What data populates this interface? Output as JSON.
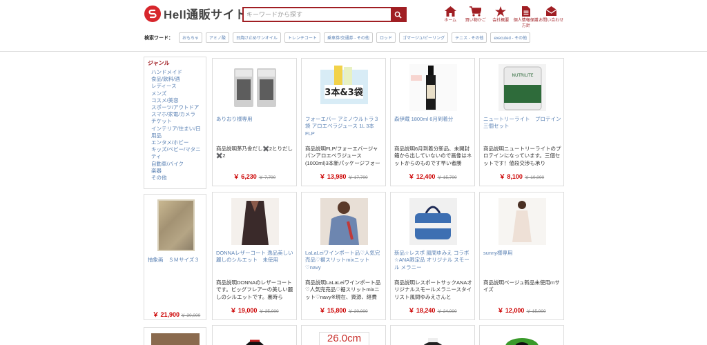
{
  "header": {
    "logo_text": "Hell通販サイト",
    "search_placeholder": "キーワードから探す",
    "nav": [
      {
        "label": "ホーム",
        "icon": "home-icon"
      },
      {
        "label": "買い物かご",
        "icon": "cart-icon"
      },
      {
        "label": "会社概要",
        "icon": "star-icon"
      },
      {
        "label": "個人情報保護方針",
        "icon": "document-icon"
      },
      {
        "label": "お問い合わせ",
        "icon": "mail-icon"
      }
    ],
    "keywords_label": "検索ワード：",
    "keywords": [
      "おもちゃ",
      "アミノ酸",
      "日焼け止めサンオイル",
      "トレンチコート",
      "乗車券/交通券 - その他",
      "ロッド",
      "ゴマージュ/ピーリング",
      "テニス - その他",
      "executed - その他"
    ]
  },
  "sidebar": {
    "genre_title": "ジャンル",
    "genres": [
      "ハンドメイド",
      "食品/飲料/酒",
      "レディース",
      "メンズ",
      "コスメ/美容",
      "スポーツ/アウトドア",
      "スマホ/家電/カメラ",
      "チケット",
      "インテリア/住まい/日用品",
      "エンタメ/ホビー",
      "キッズ/ベビー/マタニティ",
      "自動車/バイク",
      "楽器",
      "その他"
    ],
    "side_product": {
      "title": "抽象画　ＳＭサイズ３",
      "price": "￥ 21,900",
      "old_price": "￥ 30,000"
    }
  },
  "products": [
    {
      "title": "ありおり様専用",
      "desc": "商品説明茅乃舎だし✖️2とりだし✖️2",
      "price": "￥ 6,230",
      "old_price": "￥ 7,700"
    },
    {
      "title": "フォーエバー アミノウルトラ３袋 アロエベラジュース 1L 3本 FLP",
      "desc": "商品説明FLP/フォーエバージャパンアロエベラジュース(1000ml)3本新パッケージフォー",
      "price": "￥ 13,980",
      "old_price": "￥ 17,700"
    },
    {
      "title": "森伊蔵 1800ml 6月到着分",
      "desc": "商品説明6月到着分新品、未開封箱から出していないので画像はネットからのものです早い者勝",
      "price": "￥ 12,400",
      "old_price": "￥ 15,700"
    },
    {
      "title": "ニュートリーライト　プロテイン三個セット",
      "desc": "商品説明ニュートリーライトのプロテインになっています。三個セットです！値段交渉も承り",
      "price": "￥ 8,100",
      "old_price": "￥ 10,000"
    },
    {
      "title": "DONNAレザーコート 逸品美しい麗しのシルエット　未使用",
      "desc": "商品説明DONNAのレザーコートです。ビッグフレアーの美しい麗しのシルエットです。裏時ら",
      "price": "￥ 19,000",
      "old_price": "￥ 25,000"
    },
    {
      "title": "LaLaLeiワインポート品♡人気完売品♡裾スリットmixニット♡navy",
      "desc": "商品説明LaLaLeiワインポート品♡人気完売品♡裾スリットmixニット♡navy※現在、資源、経費",
      "price": "￥ 15,800",
      "old_price": "￥ 20,000"
    },
    {
      "title": "新品☆レスポ 風間ゆみえ コラボ☆ANA限定品 オリジナル スモール メラニー",
      "desc": "商品説明レスポートサックANAオリジナルスモールメラニースタイリスト風間ゆみえさんと",
      "price": "￥ 18,240",
      "old_price": "￥ 24,000"
    },
    {
      "title": "sunny様専用",
      "desc": "商品説明ベージュ新品未使用mサイズ",
      "price": "￥ 12,000",
      "old_price": "￥ 15,000"
    }
  ],
  "partial_products": [
    {
      "thumb_text": ""
    },
    {
      "thumb_text": "26.0cm"
    },
    {
      "thumb_text": ""
    },
    {
      "thumb_text": ""
    }
  ],
  "colors": {
    "accent": "#a01e23",
    "link": "#5b82b4",
    "price": "#cc0000"
  }
}
